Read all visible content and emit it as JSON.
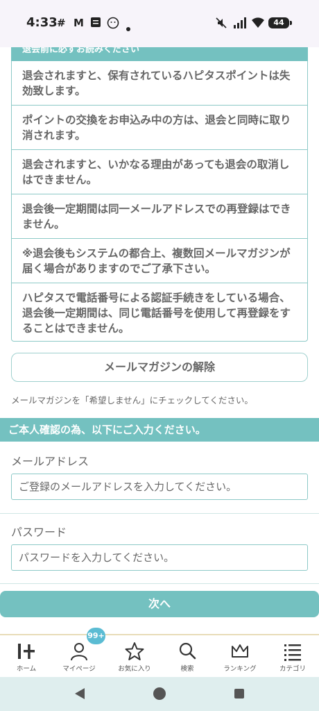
{
  "status_bar": {
    "time": "4:33",
    "battery": "44",
    "app_icons": [
      "slack-icon",
      "gmail-icon",
      "app-icon",
      "face-icon",
      "dot-icon"
    ],
    "system_icons": [
      "mute-icon",
      "signal-icon",
      "wifi-icon",
      "battery-icon"
    ]
  },
  "notice": {
    "header": "退会前に必ずお読みください",
    "items": [
      "退会されますと、保有されているハピタスポイントは失効致します。",
      "ポイントの交換をお申込み中の方は、退会と同時に取り消されます。",
      "退会されますと、いかなる理由があっても退会の取消しはできません。",
      "退会後一定期間は同一メールアドレスでの再登録はできません。",
      "※退会後もシステムの都合上、複数回メールマガジンが届く場合がありますのでご了承下さい。",
      "ハピタスで電話番号による認証手続きをしている場合、退会後一定期間は、同じ電話番号を使用して再登録をすることはできません。"
    ]
  },
  "mail_magazine": {
    "button_label": "メールマガジンの解除",
    "note": "メールマガジンを「希望しません」にチェックしてください。"
  },
  "verification": {
    "header": "ご本人確認の為、以下にご入力ください。",
    "email": {
      "label": "メールアドレス",
      "placeholder": "ご登録のメールアドレスを入力してください。",
      "value": ""
    },
    "password": {
      "label": "パスワード",
      "placeholder": "パスワードを入力してください。",
      "value": ""
    },
    "next_label": "次へ"
  },
  "tab_bar": {
    "badge": "99+",
    "tabs": [
      {
        "label": "ホーム",
        "icon": "home-icon"
      },
      {
        "label": "マイページ",
        "icon": "person-icon"
      },
      {
        "label": "お気に入り",
        "icon": "star-icon"
      },
      {
        "label": "検索",
        "icon": "search-icon"
      },
      {
        "label": "ランキング",
        "icon": "crown-icon"
      },
      {
        "label": "カテゴリ",
        "icon": "list-icon"
      }
    ]
  },
  "colors": {
    "accent": "#74c1c0",
    "border": "#8cc9c7",
    "badge": "#5bbcd3",
    "status_bar_bg": "#f7f4fa",
    "nav_bar_bg": "#dfeeee",
    "tab_bar_border": "#e8dcb8"
  }
}
